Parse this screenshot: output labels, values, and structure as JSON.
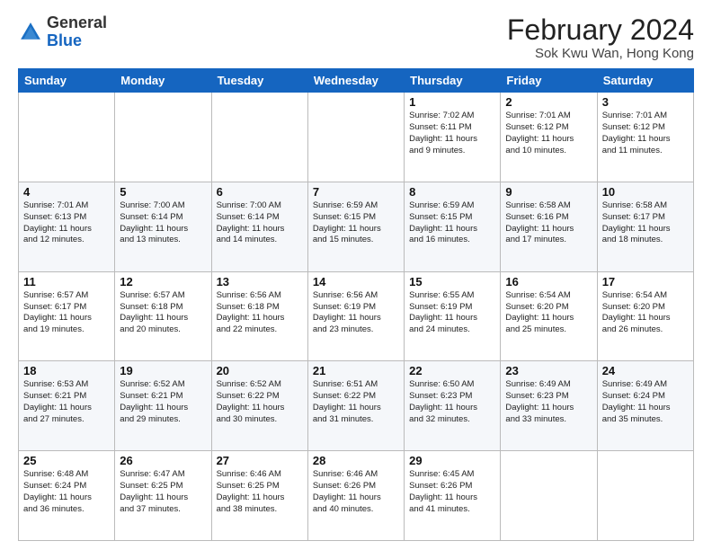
{
  "header": {
    "logo_line1": "General",
    "logo_line2": "Blue",
    "title": "February 2024",
    "subtitle": "Sok Kwu Wan, Hong Kong"
  },
  "days_of_week": [
    "Sunday",
    "Monday",
    "Tuesday",
    "Wednesday",
    "Thursday",
    "Friday",
    "Saturday"
  ],
  "weeks": [
    [
      {
        "num": "",
        "info": ""
      },
      {
        "num": "",
        "info": ""
      },
      {
        "num": "",
        "info": ""
      },
      {
        "num": "",
        "info": ""
      },
      {
        "num": "1",
        "info": "Sunrise: 7:02 AM\nSunset: 6:11 PM\nDaylight: 11 hours\nand 9 minutes."
      },
      {
        "num": "2",
        "info": "Sunrise: 7:01 AM\nSunset: 6:12 PM\nDaylight: 11 hours\nand 10 minutes."
      },
      {
        "num": "3",
        "info": "Sunrise: 7:01 AM\nSunset: 6:12 PM\nDaylight: 11 hours\nand 11 minutes."
      }
    ],
    [
      {
        "num": "4",
        "info": "Sunrise: 7:01 AM\nSunset: 6:13 PM\nDaylight: 11 hours\nand 12 minutes."
      },
      {
        "num": "5",
        "info": "Sunrise: 7:00 AM\nSunset: 6:14 PM\nDaylight: 11 hours\nand 13 minutes."
      },
      {
        "num": "6",
        "info": "Sunrise: 7:00 AM\nSunset: 6:14 PM\nDaylight: 11 hours\nand 14 minutes."
      },
      {
        "num": "7",
        "info": "Sunrise: 6:59 AM\nSunset: 6:15 PM\nDaylight: 11 hours\nand 15 minutes."
      },
      {
        "num": "8",
        "info": "Sunrise: 6:59 AM\nSunset: 6:15 PM\nDaylight: 11 hours\nand 16 minutes."
      },
      {
        "num": "9",
        "info": "Sunrise: 6:58 AM\nSunset: 6:16 PM\nDaylight: 11 hours\nand 17 minutes."
      },
      {
        "num": "10",
        "info": "Sunrise: 6:58 AM\nSunset: 6:17 PM\nDaylight: 11 hours\nand 18 minutes."
      }
    ],
    [
      {
        "num": "11",
        "info": "Sunrise: 6:57 AM\nSunset: 6:17 PM\nDaylight: 11 hours\nand 19 minutes."
      },
      {
        "num": "12",
        "info": "Sunrise: 6:57 AM\nSunset: 6:18 PM\nDaylight: 11 hours\nand 20 minutes."
      },
      {
        "num": "13",
        "info": "Sunrise: 6:56 AM\nSunset: 6:18 PM\nDaylight: 11 hours\nand 22 minutes."
      },
      {
        "num": "14",
        "info": "Sunrise: 6:56 AM\nSunset: 6:19 PM\nDaylight: 11 hours\nand 23 minutes."
      },
      {
        "num": "15",
        "info": "Sunrise: 6:55 AM\nSunset: 6:19 PM\nDaylight: 11 hours\nand 24 minutes."
      },
      {
        "num": "16",
        "info": "Sunrise: 6:54 AM\nSunset: 6:20 PM\nDaylight: 11 hours\nand 25 minutes."
      },
      {
        "num": "17",
        "info": "Sunrise: 6:54 AM\nSunset: 6:20 PM\nDaylight: 11 hours\nand 26 minutes."
      }
    ],
    [
      {
        "num": "18",
        "info": "Sunrise: 6:53 AM\nSunset: 6:21 PM\nDaylight: 11 hours\nand 27 minutes."
      },
      {
        "num": "19",
        "info": "Sunrise: 6:52 AM\nSunset: 6:21 PM\nDaylight: 11 hours\nand 29 minutes."
      },
      {
        "num": "20",
        "info": "Sunrise: 6:52 AM\nSunset: 6:22 PM\nDaylight: 11 hours\nand 30 minutes."
      },
      {
        "num": "21",
        "info": "Sunrise: 6:51 AM\nSunset: 6:22 PM\nDaylight: 11 hours\nand 31 minutes."
      },
      {
        "num": "22",
        "info": "Sunrise: 6:50 AM\nSunset: 6:23 PM\nDaylight: 11 hours\nand 32 minutes."
      },
      {
        "num": "23",
        "info": "Sunrise: 6:49 AM\nSunset: 6:23 PM\nDaylight: 11 hours\nand 33 minutes."
      },
      {
        "num": "24",
        "info": "Sunrise: 6:49 AM\nSunset: 6:24 PM\nDaylight: 11 hours\nand 35 minutes."
      }
    ],
    [
      {
        "num": "25",
        "info": "Sunrise: 6:48 AM\nSunset: 6:24 PM\nDaylight: 11 hours\nand 36 minutes."
      },
      {
        "num": "26",
        "info": "Sunrise: 6:47 AM\nSunset: 6:25 PM\nDaylight: 11 hours\nand 37 minutes."
      },
      {
        "num": "27",
        "info": "Sunrise: 6:46 AM\nSunset: 6:25 PM\nDaylight: 11 hours\nand 38 minutes."
      },
      {
        "num": "28",
        "info": "Sunrise: 6:46 AM\nSunset: 6:26 PM\nDaylight: 11 hours\nand 40 minutes."
      },
      {
        "num": "29",
        "info": "Sunrise: 6:45 AM\nSunset: 6:26 PM\nDaylight: 11 hours\nand 41 minutes."
      },
      {
        "num": "",
        "info": ""
      },
      {
        "num": "",
        "info": ""
      }
    ]
  ]
}
